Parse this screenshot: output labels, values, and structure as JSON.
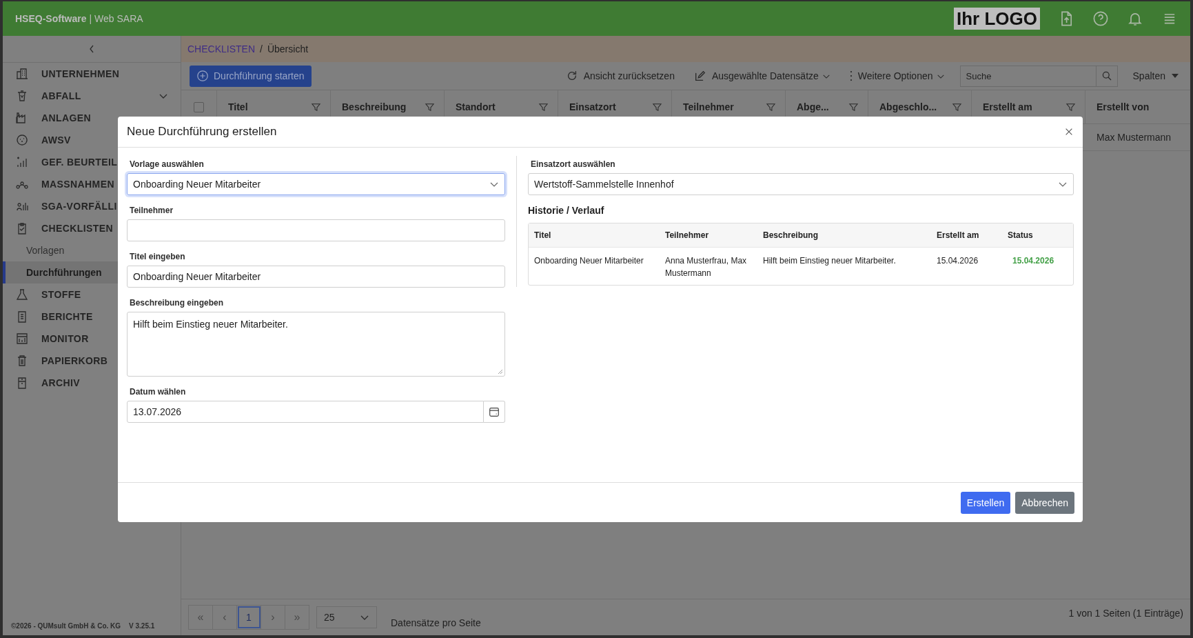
{
  "topbar": {
    "brand": "HSEQ-Software",
    "separator": "|",
    "product": "Web SARA",
    "logo": "Ihr LOGO"
  },
  "sidebar": {
    "items": [
      {
        "label": "UNTERNEHMEN",
        "kind": "link"
      },
      {
        "label": "ABFALL",
        "kind": "group"
      },
      {
        "label": "ANLAGEN",
        "kind": "link"
      },
      {
        "label": "AWSV",
        "kind": "link"
      },
      {
        "label": "GEF. BEURTEIL",
        "kind": "link"
      },
      {
        "label": "MASSNAHMEN",
        "kind": "link"
      },
      {
        "label": "SGA-VORFÄLLI",
        "kind": "link"
      },
      {
        "label": "CHECKLISTEN",
        "kind": "link",
        "children": [
          {
            "label": "Vorlagen",
            "selected": false
          },
          {
            "label": "Durchführungen",
            "selected": true
          }
        ]
      },
      {
        "label": "STOFFE",
        "kind": "link"
      },
      {
        "label": "BERICHTE",
        "kind": "link"
      },
      {
        "label": "MONITOR",
        "kind": "link"
      },
      {
        "label": "PAPIERKORB",
        "kind": "link"
      },
      {
        "label": "ARCHIV",
        "kind": "link"
      }
    ],
    "copyright": "©2026 - QUMsult GmbH & Co. KG",
    "version": "V 3.25.1"
  },
  "breadcrumb": [
    {
      "label": "CHECKLISTEN",
      "kind": "link"
    },
    {
      "label": "/",
      "kind": "separator"
    },
    {
      "label": "Übersicht",
      "kind": "current"
    }
  ],
  "toolbar": {
    "primary": "Durchführung starten",
    "actions": [
      {
        "label": "Ansicht zurücksetzen",
        "dropdown": false
      },
      {
        "label": "Ausgewählte Datensätze",
        "dropdown": true
      },
      {
        "label": "Weitere Optionen",
        "dropdown": true
      }
    ],
    "search_placeholder": "Suche",
    "columns_button": "Spalten"
  },
  "table": {
    "select_all_checked": false,
    "columns": [
      {
        "label": "Titel",
        "filter": true
      },
      {
        "label": "Beschreibung",
        "filter": true
      },
      {
        "label": "Standort",
        "filter": true
      },
      {
        "label": "Einsatzort",
        "filter": true
      },
      {
        "label": "Teilnehmer",
        "filter": true
      },
      {
        "label": "Abge...",
        "filter": true
      },
      {
        "label": "Abgeschlo...",
        "filter": true
      },
      {
        "label": "Erstellt am",
        "filter": true
      },
      {
        "label": "Erstellt von",
        "filter": false
      }
    ],
    "rows": [
      {
        "erstellt_von": "Max Mustermann"
      }
    ]
  },
  "pagination": {
    "first": "«",
    "previous": "‹",
    "pages": [
      {
        "label": "1",
        "selected": true
      }
    ],
    "next": "›",
    "last": "»",
    "page_size": "25",
    "page_size_label": "Datensätze pro Seite",
    "summary": "1 von 1 Seiten (1 Einträge)"
  },
  "modal": {
    "title": "Neue Durchführung erstellen",
    "left_fields": [
      {
        "kind": "select",
        "label": "Vorlage auswählen",
        "value": "Onboarding Neuer Mitarbeiter",
        "focused": true
      },
      {
        "kind": "input",
        "label": "Teilnehmer",
        "focused": false
      },
      {
        "kind": "input",
        "label": "Titel eingeben",
        "value": "Onboarding Neuer Mitarbeiter",
        "focused": false
      },
      {
        "kind": "textarea",
        "label": "Beschreibung eingeben",
        "value": "Hilft beim Einstieg neuer Mitarbeiter.",
        "focused": false
      },
      {
        "kind": "date",
        "label": "Datum wählen",
        "value": "13.07.2026",
        "focused": false
      }
    ],
    "location": {
      "label": "Einsatzort auswählen",
      "value": "Wertstoff-Sammelstelle Innenhof"
    },
    "history": {
      "title": "Historie / Verlauf",
      "columns": [
        "Titel",
        "Teilnehmer",
        "Beschreibung",
        "Erstellt am",
        "Status"
      ],
      "rows": [
        {
          "title": "Onboarding Neuer Mitarbeiter",
          "participants": "Anna Musterfrau, Max Mustermann",
          "description": "Hilft beim Einstieg neuer Mitarbeiter.",
          "created": "15.04.2026",
          "status": "15.04.2026"
        }
      ]
    },
    "buttons": [
      {
        "label": "Erstellen",
        "kind": "primary"
      },
      {
        "label": "Abbrechen",
        "kind": "secondary"
      }
    ]
  }
}
